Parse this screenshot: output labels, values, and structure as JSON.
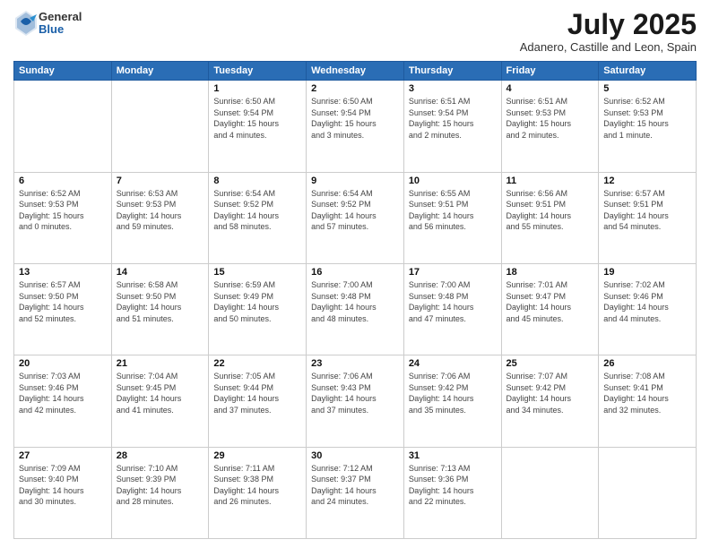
{
  "header": {
    "logo_general": "General",
    "logo_blue": "Blue",
    "title": "July 2025",
    "location": "Adanero, Castille and Leon, Spain"
  },
  "weekdays": [
    "Sunday",
    "Monday",
    "Tuesday",
    "Wednesday",
    "Thursday",
    "Friday",
    "Saturday"
  ],
  "weeks": [
    [
      {
        "day": "",
        "info": ""
      },
      {
        "day": "",
        "info": ""
      },
      {
        "day": "1",
        "info": "Sunrise: 6:50 AM\nSunset: 9:54 PM\nDaylight: 15 hours\nand 4 minutes."
      },
      {
        "day": "2",
        "info": "Sunrise: 6:50 AM\nSunset: 9:54 PM\nDaylight: 15 hours\nand 3 minutes."
      },
      {
        "day": "3",
        "info": "Sunrise: 6:51 AM\nSunset: 9:54 PM\nDaylight: 15 hours\nand 2 minutes."
      },
      {
        "day": "4",
        "info": "Sunrise: 6:51 AM\nSunset: 9:53 PM\nDaylight: 15 hours\nand 2 minutes."
      },
      {
        "day": "5",
        "info": "Sunrise: 6:52 AM\nSunset: 9:53 PM\nDaylight: 15 hours\nand 1 minute."
      }
    ],
    [
      {
        "day": "6",
        "info": "Sunrise: 6:52 AM\nSunset: 9:53 PM\nDaylight: 15 hours\nand 0 minutes."
      },
      {
        "day": "7",
        "info": "Sunrise: 6:53 AM\nSunset: 9:53 PM\nDaylight: 14 hours\nand 59 minutes."
      },
      {
        "day": "8",
        "info": "Sunrise: 6:54 AM\nSunset: 9:52 PM\nDaylight: 14 hours\nand 58 minutes."
      },
      {
        "day": "9",
        "info": "Sunrise: 6:54 AM\nSunset: 9:52 PM\nDaylight: 14 hours\nand 57 minutes."
      },
      {
        "day": "10",
        "info": "Sunrise: 6:55 AM\nSunset: 9:51 PM\nDaylight: 14 hours\nand 56 minutes."
      },
      {
        "day": "11",
        "info": "Sunrise: 6:56 AM\nSunset: 9:51 PM\nDaylight: 14 hours\nand 55 minutes."
      },
      {
        "day": "12",
        "info": "Sunrise: 6:57 AM\nSunset: 9:51 PM\nDaylight: 14 hours\nand 54 minutes."
      }
    ],
    [
      {
        "day": "13",
        "info": "Sunrise: 6:57 AM\nSunset: 9:50 PM\nDaylight: 14 hours\nand 52 minutes."
      },
      {
        "day": "14",
        "info": "Sunrise: 6:58 AM\nSunset: 9:50 PM\nDaylight: 14 hours\nand 51 minutes."
      },
      {
        "day": "15",
        "info": "Sunrise: 6:59 AM\nSunset: 9:49 PM\nDaylight: 14 hours\nand 50 minutes."
      },
      {
        "day": "16",
        "info": "Sunrise: 7:00 AM\nSunset: 9:48 PM\nDaylight: 14 hours\nand 48 minutes."
      },
      {
        "day": "17",
        "info": "Sunrise: 7:00 AM\nSunset: 9:48 PM\nDaylight: 14 hours\nand 47 minutes."
      },
      {
        "day": "18",
        "info": "Sunrise: 7:01 AM\nSunset: 9:47 PM\nDaylight: 14 hours\nand 45 minutes."
      },
      {
        "day": "19",
        "info": "Sunrise: 7:02 AM\nSunset: 9:46 PM\nDaylight: 14 hours\nand 44 minutes."
      }
    ],
    [
      {
        "day": "20",
        "info": "Sunrise: 7:03 AM\nSunset: 9:46 PM\nDaylight: 14 hours\nand 42 minutes."
      },
      {
        "day": "21",
        "info": "Sunrise: 7:04 AM\nSunset: 9:45 PM\nDaylight: 14 hours\nand 41 minutes."
      },
      {
        "day": "22",
        "info": "Sunrise: 7:05 AM\nSunset: 9:44 PM\nDaylight: 14 hours\nand 37 minutes."
      },
      {
        "day": "23",
        "info": "Sunrise: 7:06 AM\nSunset: 9:43 PM\nDaylight: 14 hours\nand 37 minutes."
      },
      {
        "day": "24",
        "info": "Sunrise: 7:06 AM\nSunset: 9:42 PM\nDaylight: 14 hours\nand 35 minutes."
      },
      {
        "day": "25",
        "info": "Sunrise: 7:07 AM\nSunset: 9:42 PM\nDaylight: 14 hours\nand 34 minutes."
      },
      {
        "day": "26",
        "info": "Sunrise: 7:08 AM\nSunset: 9:41 PM\nDaylight: 14 hours\nand 32 minutes."
      }
    ],
    [
      {
        "day": "27",
        "info": "Sunrise: 7:09 AM\nSunset: 9:40 PM\nDaylight: 14 hours\nand 30 minutes."
      },
      {
        "day": "28",
        "info": "Sunrise: 7:10 AM\nSunset: 9:39 PM\nDaylight: 14 hours\nand 28 minutes."
      },
      {
        "day": "29",
        "info": "Sunrise: 7:11 AM\nSunset: 9:38 PM\nDaylight: 14 hours\nand 26 minutes."
      },
      {
        "day": "30",
        "info": "Sunrise: 7:12 AM\nSunset: 9:37 PM\nDaylight: 14 hours\nand 24 minutes."
      },
      {
        "day": "31",
        "info": "Sunrise: 7:13 AM\nSunset: 9:36 PM\nDaylight: 14 hours\nand 22 minutes."
      },
      {
        "day": "",
        "info": ""
      },
      {
        "day": "",
        "info": ""
      }
    ]
  ]
}
